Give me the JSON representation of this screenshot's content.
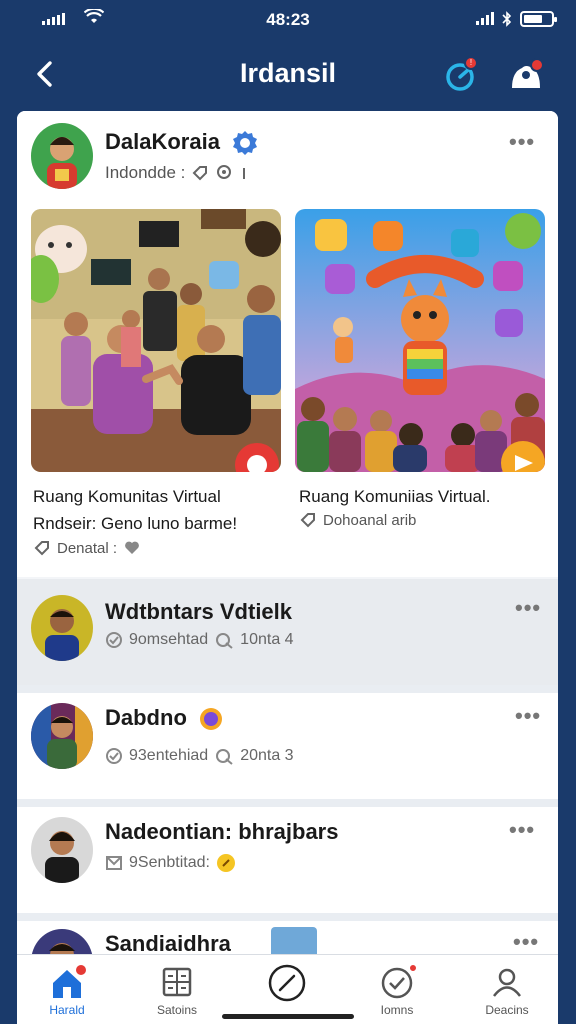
{
  "status_bar": {
    "time": "48:23"
  },
  "header": {
    "title": "Irdansil",
    "back_icon": "chevron-left-icon",
    "notification_icon": "notification-icon",
    "profile_icon": "profile-badge-icon"
  },
  "post": {
    "name": "DalaKoraia",
    "meta": "Indondde :",
    "media": [
      {
        "caption_line1": "Ruang Komunitas Virtual",
        "caption_line2": "Rndseir: Geno luno barme!",
        "tag": "Denatal :"
      },
      {
        "caption_line1": "Ruang Komuniias Virtual.",
        "caption_line2": "",
        "tag": "Dohoanal arib"
      }
    ]
  },
  "rows": [
    {
      "name": "Wdtbntars Vdtielk",
      "meta_a": "9omsehtad",
      "meta_b": "10nta 4"
    },
    {
      "name": "Dabdno",
      "meta_a": "93entehiad",
      "meta_b": "20nta 3"
    },
    {
      "name": "Nadeontian: bhrajbars",
      "meta_a": "9Senbtitad:",
      "meta_b": ""
    },
    {
      "name": "Sandiaidhra",
      "meta_a": "",
      "meta_b": ""
    }
  ],
  "tabs": [
    {
      "label": "Harald",
      "icon": "home-icon"
    },
    {
      "label": "Satoins",
      "icon": "grid-icon"
    },
    {
      "label": "",
      "icon": "compass-icon"
    },
    {
      "label": "Iomns",
      "icon": "check-badge-icon"
    },
    {
      "label": "Deacins",
      "icon": "user-icon"
    }
  ],
  "colors": {
    "header_bg": "#1a3a6b",
    "accent": "#1e6fd9",
    "badge": "#e53935"
  }
}
